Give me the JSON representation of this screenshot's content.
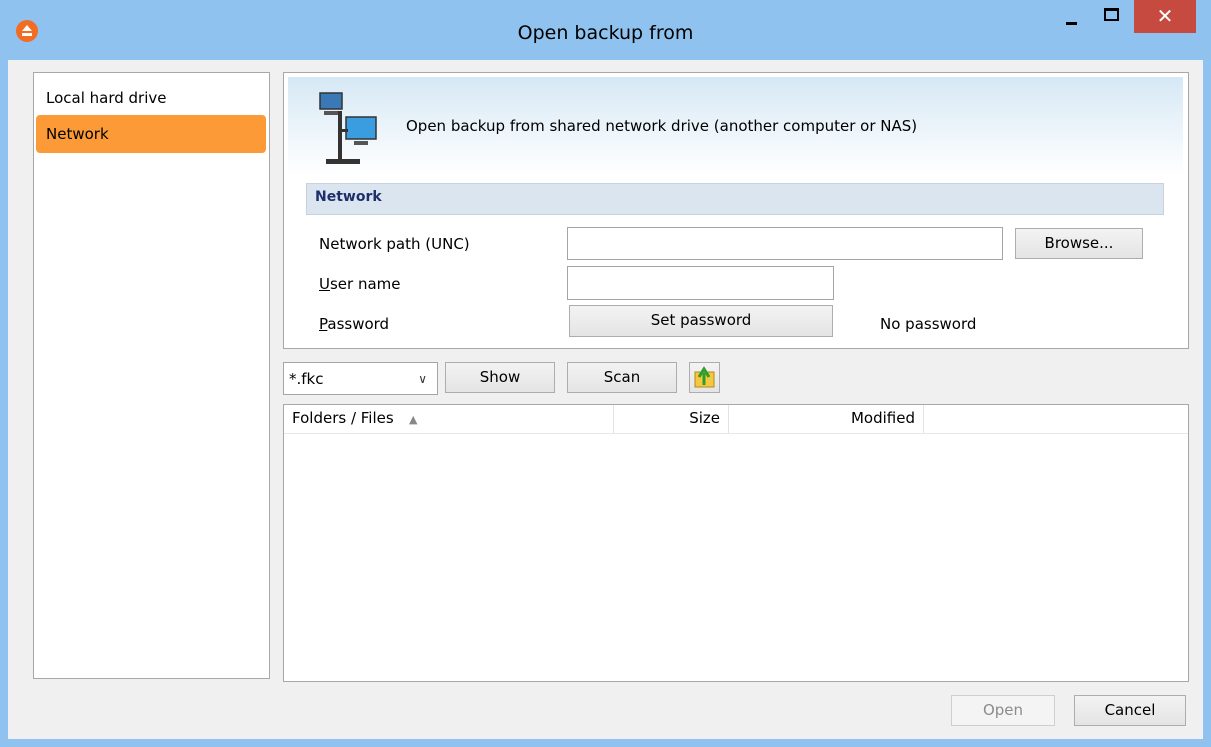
{
  "window": {
    "title": "Open backup from"
  },
  "titlebar_buttons": {
    "minimize": "–",
    "maximize": "",
    "close": "✕"
  },
  "nav": {
    "items": [
      {
        "label": "Local hard drive",
        "selected": false
      },
      {
        "label": "Network",
        "selected": true
      }
    ]
  },
  "banner": {
    "text": "Open backup from shared network drive (another computer or NAS)",
    "icon": "network-computers-icon"
  },
  "section": {
    "title": "Network"
  },
  "form": {
    "network_path_label": "Network path (UNC)",
    "network_path_value": "",
    "browse_button": "Browse...",
    "username_label_u": "U",
    "username_label_rest": "ser name",
    "username_value": "",
    "password_label_u": "P",
    "password_label_rest": "assword",
    "set_password_button": "Set password",
    "password_status": "No password"
  },
  "toolbar": {
    "filter_value": "*.fkc",
    "show_button": "Show",
    "scan_button": "Scan",
    "up_icon": "folder-up-icon"
  },
  "file_list": {
    "columns": [
      "Folders / Files",
      "Size",
      "Modified"
    ],
    "sort_indicator": "▲",
    "rows": []
  },
  "footer": {
    "open_button": "Open",
    "cancel_button": "Cancel"
  },
  "colors": {
    "titlebar": "#8fc2ef",
    "selected_nav": "#fb9a37",
    "close_button": "#c74a40"
  }
}
